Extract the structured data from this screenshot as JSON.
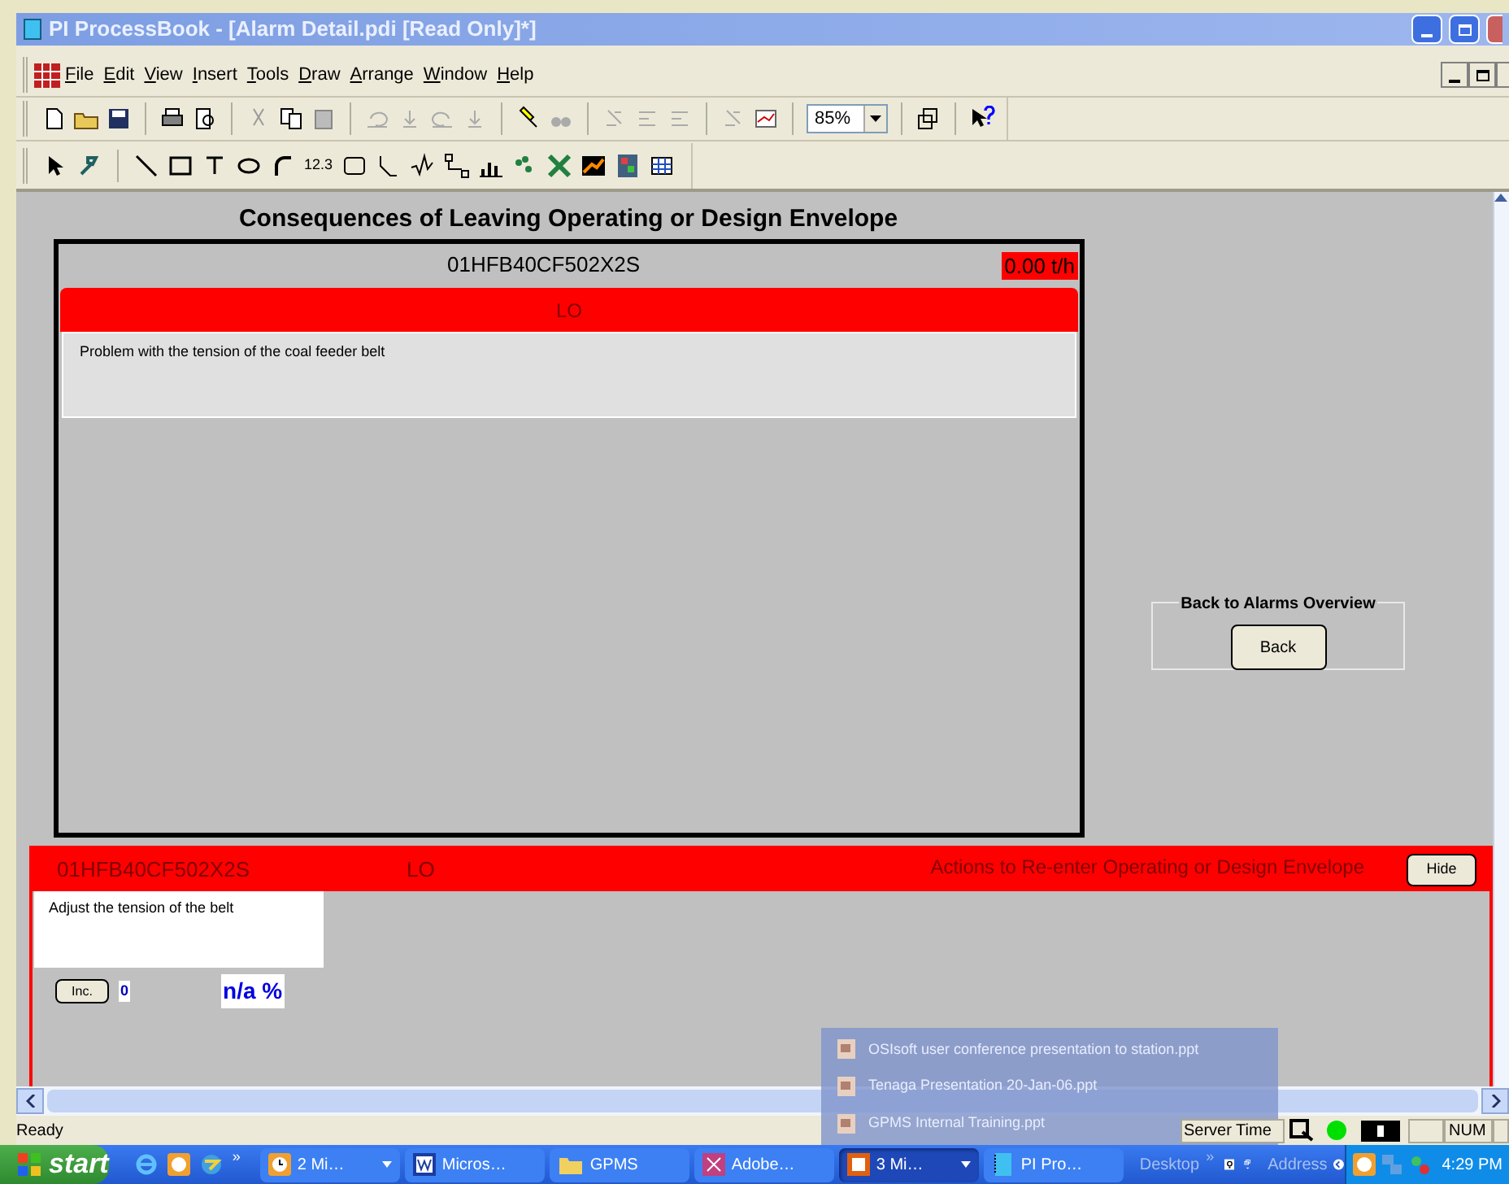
{
  "window": {
    "title": "PI ProcessBook - [Alarm Detail.pdi [Read Only]*]"
  },
  "menu": [
    "File",
    "Edit",
    "View",
    "Insert",
    "Tools",
    "Draw",
    "Arrange",
    "Window",
    "Help"
  ],
  "toolbar": {
    "zoom": "85%"
  },
  "draw_toolbar": {
    "value_tool": "12.3"
  },
  "display": {
    "title": "Consequences of Leaving Operating or Design Envelope",
    "tag": "01HFB40CF502X2S",
    "reading": "0.00 t/h",
    "state": "LO",
    "description": "Problem with the tension of the coal feeder belt",
    "back_group": {
      "label": "Back to Alarms Overview",
      "button": "Back"
    }
  },
  "actions_panel": {
    "tag": "01HFB40CF502X2S",
    "state": "LO",
    "title": "Actions to Re-enter Operating or Design Envelope",
    "hide_button": "Hide",
    "action": "Adjust the tension of the belt",
    "inc_button": "Inc.",
    "count": "0",
    "percent": "n/a %"
  },
  "status_bar": {
    "text": "Ready",
    "server_time": "Server Time",
    "num": "NUM"
  },
  "jump_list": [
    "OSIsoft user conference presentation to station.ppt",
    "Tenaga Presentation 20-Jan-06.ppt",
    "GPMS Internal Training.ppt"
  ],
  "taskbar": {
    "start": "start",
    "quick_launch_more": "»",
    "items": [
      {
        "label": "2 Mi…",
        "kind": "clock",
        "grouped": true,
        "selected": false
      },
      {
        "label": "Micros…",
        "kind": "word",
        "grouped": false,
        "selected": false
      },
      {
        "label": "GPMS",
        "kind": "folder",
        "grouped": false,
        "selected": false
      },
      {
        "label": "Adobe…",
        "kind": "acrobat",
        "grouped": false,
        "selected": false
      },
      {
        "label": "3 Mi…",
        "kind": "slides",
        "grouped": true,
        "selected": true
      },
      {
        "label": "PI Pro…",
        "kind": "book",
        "grouped": false,
        "selected": false
      }
    ],
    "desktop": "Desktop",
    "toolbar_more": "»",
    "address": "Address",
    "clock": "4:29 PM"
  }
}
